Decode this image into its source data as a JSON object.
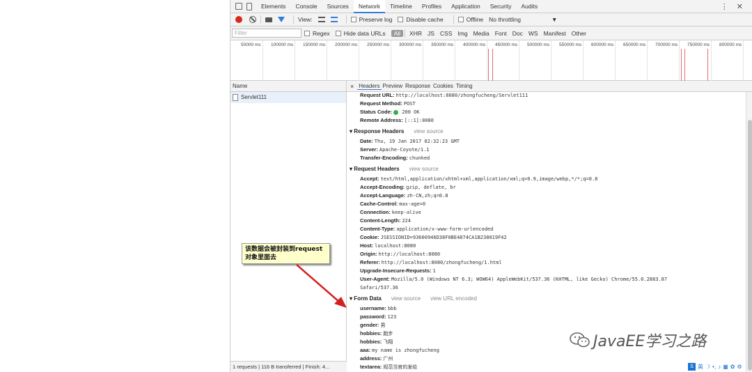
{
  "top_tabs": [
    "Elements",
    "Console",
    "Sources",
    "Network",
    "Timeline",
    "Profiles",
    "Application",
    "Security",
    "Audits"
  ],
  "active_tab": "Network",
  "toolbar": {
    "view_label": "View:",
    "preserve_log": "Preserve log",
    "disable_cache": "Disable cache",
    "offline": "Offline",
    "throttling": "No throttling"
  },
  "filterbar": {
    "placeholder": "Filter",
    "regex": "Regex",
    "hide_data_urls": "Hide data URLs",
    "types": [
      "All",
      "XHR",
      "JS",
      "CSS",
      "Img",
      "Media",
      "Font",
      "Doc",
      "WS",
      "Manifest",
      "Other"
    ]
  },
  "timeline_ticks": [
    "50000 ms",
    "100000 ms",
    "150000 ms",
    "200000 ms",
    "250000 ms",
    "300000 ms",
    "350000 ms",
    "400000 ms",
    "450000 ms",
    "500000 ms",
    "550000 ms",
    "600000 ms",
    "650000 ms",
    "700000 ms",
    "750000 ms",
    "800000 ms"
  ],
  "left_pane": {
    "header": "Name",
    "request": "Servlet111",
    "status": "1 requests | 116 B transferred | Finish: 4..."
  },
  "detail_tabs": [
    "Headers",
    "Preview",
    "Response",
    "Cookies",
    "Timing"
  ],
  "close_glyph": "×",
  "general": {
    "request_url_k": "Request URL:",
    "request_url_v": "http://localhost:8080/zhongfucheng/Servlet111",
    "method_k": "Request Method:",
    "method_v": "POST",
    "status_k": "Status Code:",
    "status_v": "200 OK",
    "remote_k": "Remote Address:",
    "remote_v": "[::1]:8080"
  },
  "response_headers": {
    "title": "Response Headers",
    "view_source": "view source",
    "date_k": "Date:",
    "date_v": "Thu, 19 Jan 2017 02:32:23 GMT",
    "server_k": "Server:",
    "server_v": "Apache-Coyote/1.1",
    "te_k": "Transfer-Encoding:",
    "te_v": "chunked"
  },
  "request_headers": {
    "title": "Request Headers",
    "view_source": "view source",
    "accept_k": "Accept:",
    "accept_v": "text/html,application/xhtml+xml,application/xml;q=0.9,image/webp,*/*;q=0.8",
    "ae_k": "Accept-Encoding:",
    "ae_v": "gzip, deflate, br",
    "al_k": "Accept-Language:",
    "al_v": "zh-CN,zh;q=0.8",
    "cc_k": "Cache-Control:",
    "cc_v": "max-age=0",
    "conn_k": "Connection:",
    "conn_v": "keep-alive",
    "cl_k": "Content-Length:",
    "cl_v": "224",
    "ct_k": "Content-Type:",
    "ct_v": "application/x-www-form-urlencoded",
    "cookie_k": "Cookie:",
    "cookie_v": "JSESSIONID=93600946D38F0BE4874CA1B238019F42",
    "host_k": "Host:",
    "host_v": "localhost:8080",
    "origin_k": "Origin:",
    "origin_v": "http://localhost:8080",
    "ref_k": "Referer:",
    "ref_v": "http://localhost:8080/zhongfucheng/1.html",
    "uir_k": "Upgrade-Insecure-Requests:",
    "uir_v": "1",
    "ua_k": "User-Agent:",
    "ua_v": "Mozilla/5.0 (Windows NT 6.3; WOW64) AppleWebKit/537.36 (KHTML, like Gecko) Chrome/55.0.2883.87",
    "ua_v2": "Safari/537.36"
  },
  "form_data": {
    "title": "Form Data",
    "view_source": "view source",
    "view_url": "view URL encoded",
    "username_k": "username:",
    "username_v": "bbb",
    "password_k": "password:",
    "password_v": "123",
    "gender_k": "gender:",
    "gender_v": "男",
    "hobbies1_k": "hobbies:",
    "hobbies1_v": "跑步",
    "hobbies2_k": "hobbies:",
    "hobbies2_v": "飞翔",
    "aaa_k": "aaa:",
    "aaa_v": "my name is zhongfucheng",
    "address_k": "address:",
    "address_v": "广州",
    "textarea_k": "textarea:",
    "textarea_v": "规范当官的发给"
  },
  "callout": {
    "line1": "该数据会被封装到request",
    "line2": "对象里面去"
  },
  "watermark": "JavaEE学习之路",
  "taskbar": {
    "ime_icon": "S",
    "lang": "英"
  },
  "colors": {
    "accent": "#3879d9",
    "record": "#d9281c",
    "status_ok": "#37b04a",
    "callout_bg": "#ffffcc",
    "arrow": "#d42020"
  }
}
